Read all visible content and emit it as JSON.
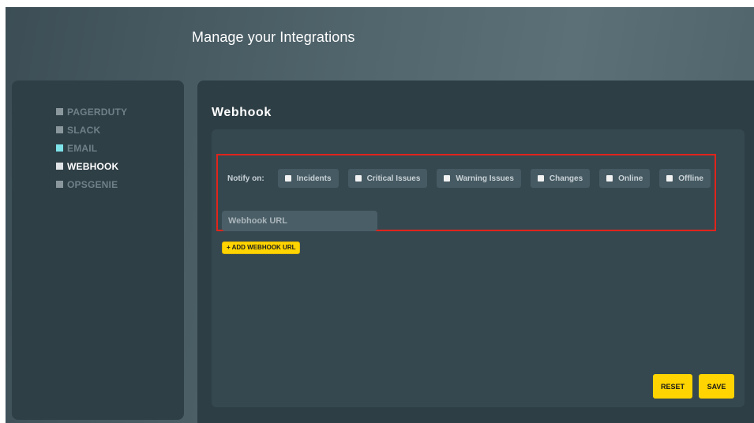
{
  "page": {
    "title": "Manage your Integrations"
  },
  "sidebar": {
    "items": [
      {
        "label": "PAGERDUTY"
      },
      {
        "label": "SLACK"
      },
      {
        "label": "EMAIL"
      },
      {
        "label": "WEBHOOK"
      },
      {
        "label": "OPSGENIE"
      }
    ],
    "active": "WEBHOOK"
  },
  "main": {
    "section_title": "Webhook",
    "notify_label": "Notify on:",
    "notify_options": [
      {
        "label": "Incidents",
        "checked": false
      },
      {
        "label": "Critical Issues",
        "checked": false
      },
      {
        "label": "Warning Issues",
        "checked": false
      },
      {
        "label": "Changes",
        "checked": false
      },
      {
        "label": "Online",
        "checked": false
      },
      {
        "label": "Offline",
        "checked": false
      }
    ],
    "webhook_url": {
      "placeholder": "Webhook URL",
      "value": ""
    },
    "add_button": "+ ADD WEBHOOK URL",
    "reset_button": "RESET",
    "save_button": "SAVE"
  },
  "colors": {
    "accent": "#ffd400",
    "highlight_border": "#e0241b",
    "email_marker": "#7fe3ea",
    "panel": "#2e3e45"
  }
}
